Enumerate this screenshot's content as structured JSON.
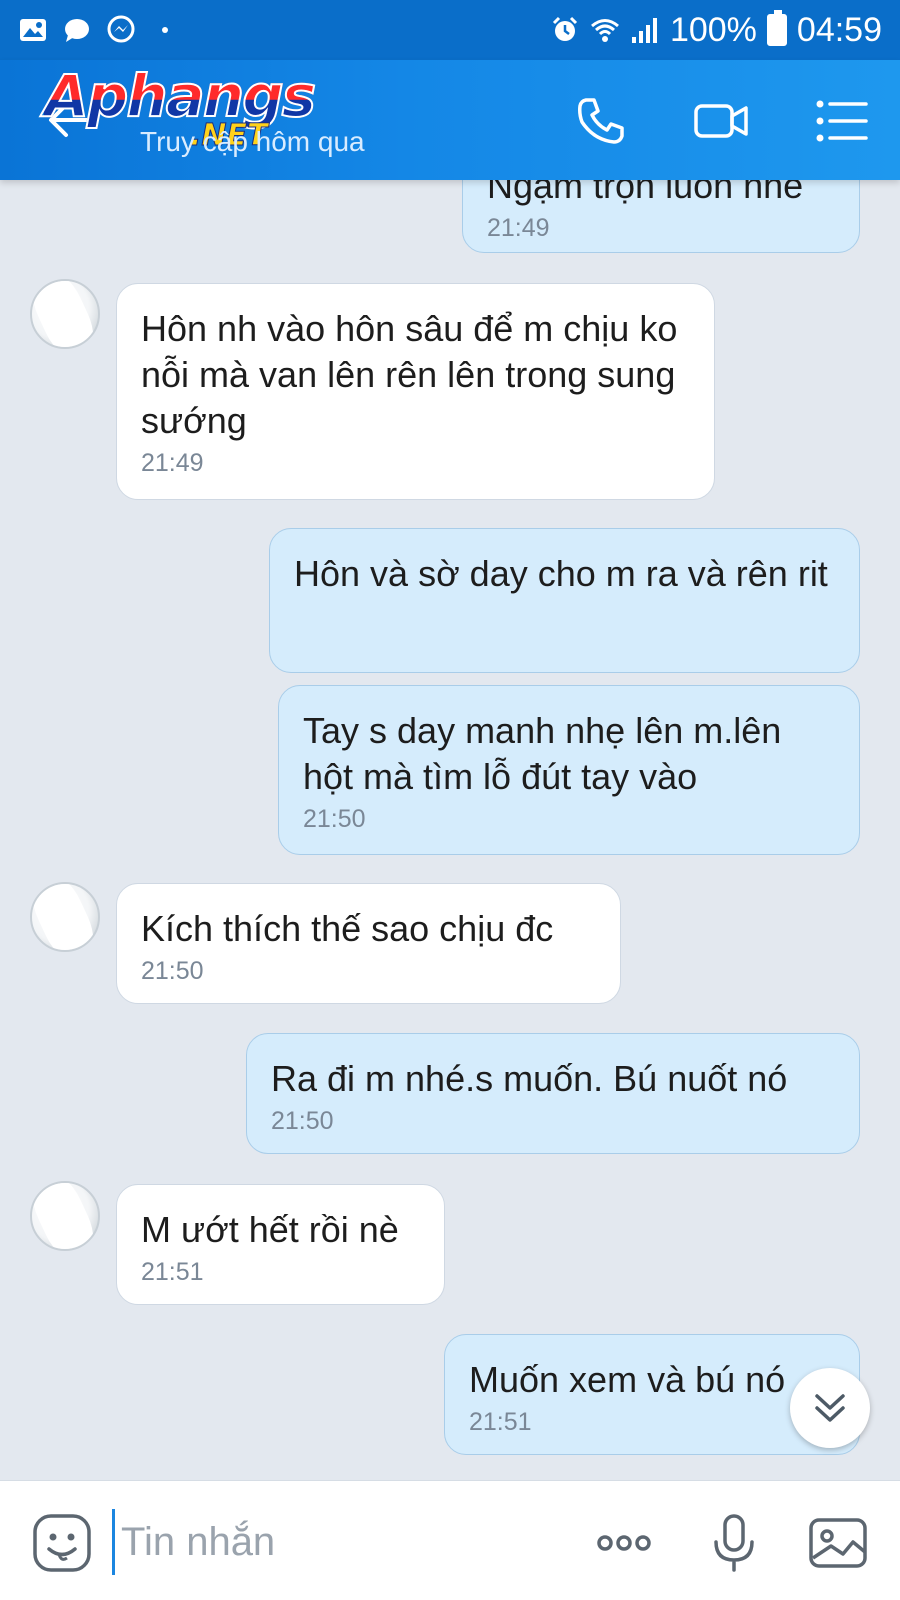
{
  "status_bar": {
    "battery": "100%",
    "time": "04:59",
    "icons": [
      "gallery-icon",
      "chat-bubble-icon",
      "messenger-icon",
      "dot-icon",
      "alarm-icon",
      "wifi-icon",
      "signal-icon",
      "battery-icon"
    ]
  },
  "header": {
    "logo_main": "Aphangs",
    "logo_sub": ".NET",
    "status_text": "Truy cập hôm qua",
    "accent_color": "#1487e6"
  },
  "messages": [
    {
      "side": "out",
      "text": "Ngậm trọn luôn nhé",
      "time": "21:49"
    },
    {
      "side": "in",
      "text": "Hôn nh vào hôn sâu để m chịu ko nỗi mà van lên rên lên trong sung sướng",
      "time": "21:49"
    },
    {
      "side": "out",
      "text": "Hôn và sờ day cho m ra và rên rit",
      "time": ""
    },
    {
      "side": "out",
      "text": "Tay s day manh nhẹ lên m.lên hột mà tìm lỗ đút tay vào",
      "time": "21:50"
    },
    {
      "side": "in",
      "text": "Kích thích thế sao chịu đc",
      "time": "21:50"
    },
    {
      "side": "out",
      "text": "Ra đi m nhé.s muốn. Bú nuốt nó",
      "time": "21:50"
    },
    {
      "side": "in",
      "text": "M ướt hết rồi nè",
      "time": "21:51"
    },
    {
      "side": "out",
      "text": "Muốn xem và bú nó",
      "time": "21:51"
    }
  ],
  "input": {
    "placeholder": "Tin nhắn"
  }
}
